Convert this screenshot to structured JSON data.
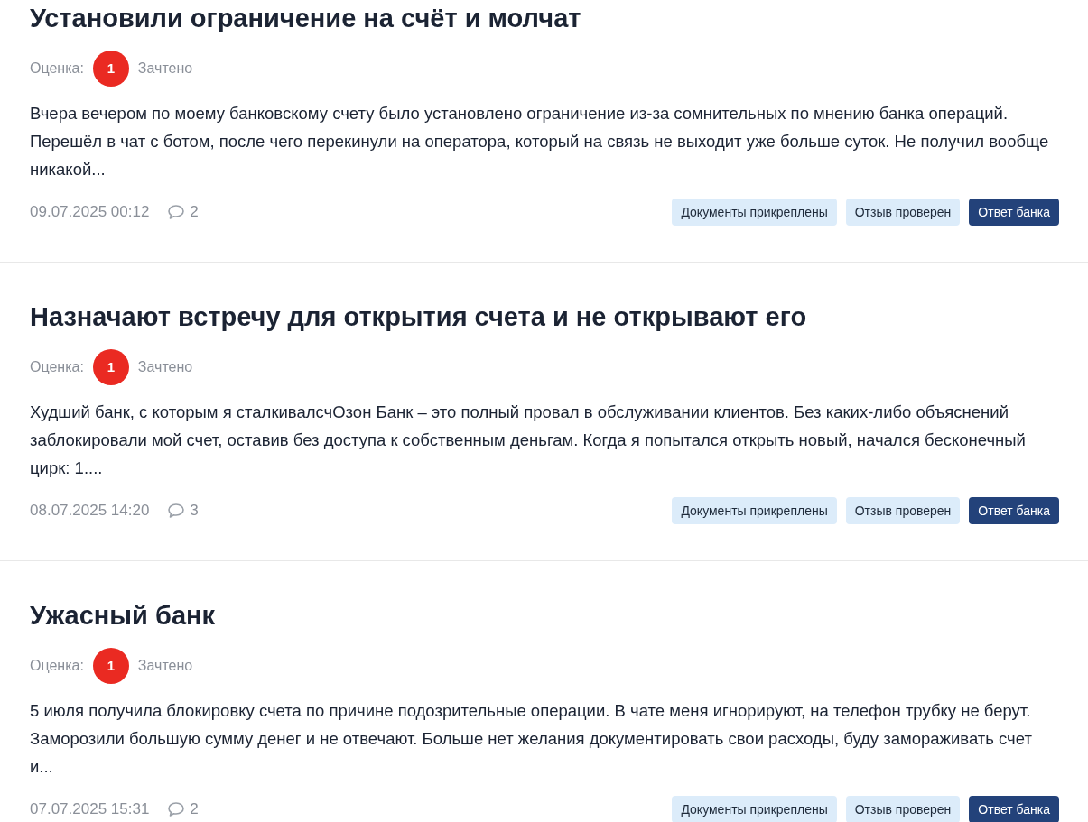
{
  "reviews": [
    {
      "title": "Установили ограничение на счёт и молчат",
      "rating_label": "Оценка:",
      "rating": "1",
      "rating_status": "Зачтено",
      "text": "Вчера вечером по моему банковскому счету было установлено ограничение из-за сомнительных по мнению банка операций. Перешёл в чат с ботом, после чего перекинули на оператора, который на связь не выходит уже больше суток. Не получил вообще никакой...",
      "date": "09.07.2025 00:12",
      "comments": "2",
      "tags": [
        {
          "label": "Документы прикреплены",
          "kind": "light"
        },
        {
          "label": "Отзыв проверен",
          "kind": "light"
        },
        {
          "label": "Ответ банка",
          "kind": "dark"
        }
      ]
    },
    {
      "title": "Назначают встречу для открытия счета и не открывают его",
      "rating_label": "Оценка:",
      "rating": "1",
      "rating_status": "Зачтено",
      "text": "Худший банк, с которым я сталкивалсчОзон Банк – это полный провал в обслуживании клиентов. Без каких-либо объяснений заблокировали мой счет, оставив без доступа к собственным деньгам. Когда я попытался открыть новый, начался бесконечный цирк: 1....",
      "date": "08.07.2025 14:20",
      "comments": "3",
      "tags": [
        {
          "label": "Документы прикреплены",
          "kind": "light"
        },
        {
          "label": "Отзыв проверен",
          "kind": "light"
        },
        {
          "label": "Ответ банка",
          "kind": "dark"
        }
      ]
    },
    {
      "title": "Ужасный банк",
      "rating_label": "Оценка:",
      "rating": "1",
      "rating_status": "Зачтено",
      "text": "5 июля получила блокировку счета по причине подозрительные операции. В чате меня игнорируют, на телефон трубку не берут. Заморозили большую сумму денег и не отвечают. Больше нет желания документировать свои расходы, буду замораживать счет и...",
      "date": "07.07.2025 15:31",
      "comments": "2",
      "tags": [
        {
          "label": "Документы прикреплены",
          "kind": "light"
        },
        {
          "label": "Отзыв проверен",
          "kind": "light"
        },
        {
          "label": "Ответ банка",
          "kind": "dark"
        }
      ]
    }
  ]
}
